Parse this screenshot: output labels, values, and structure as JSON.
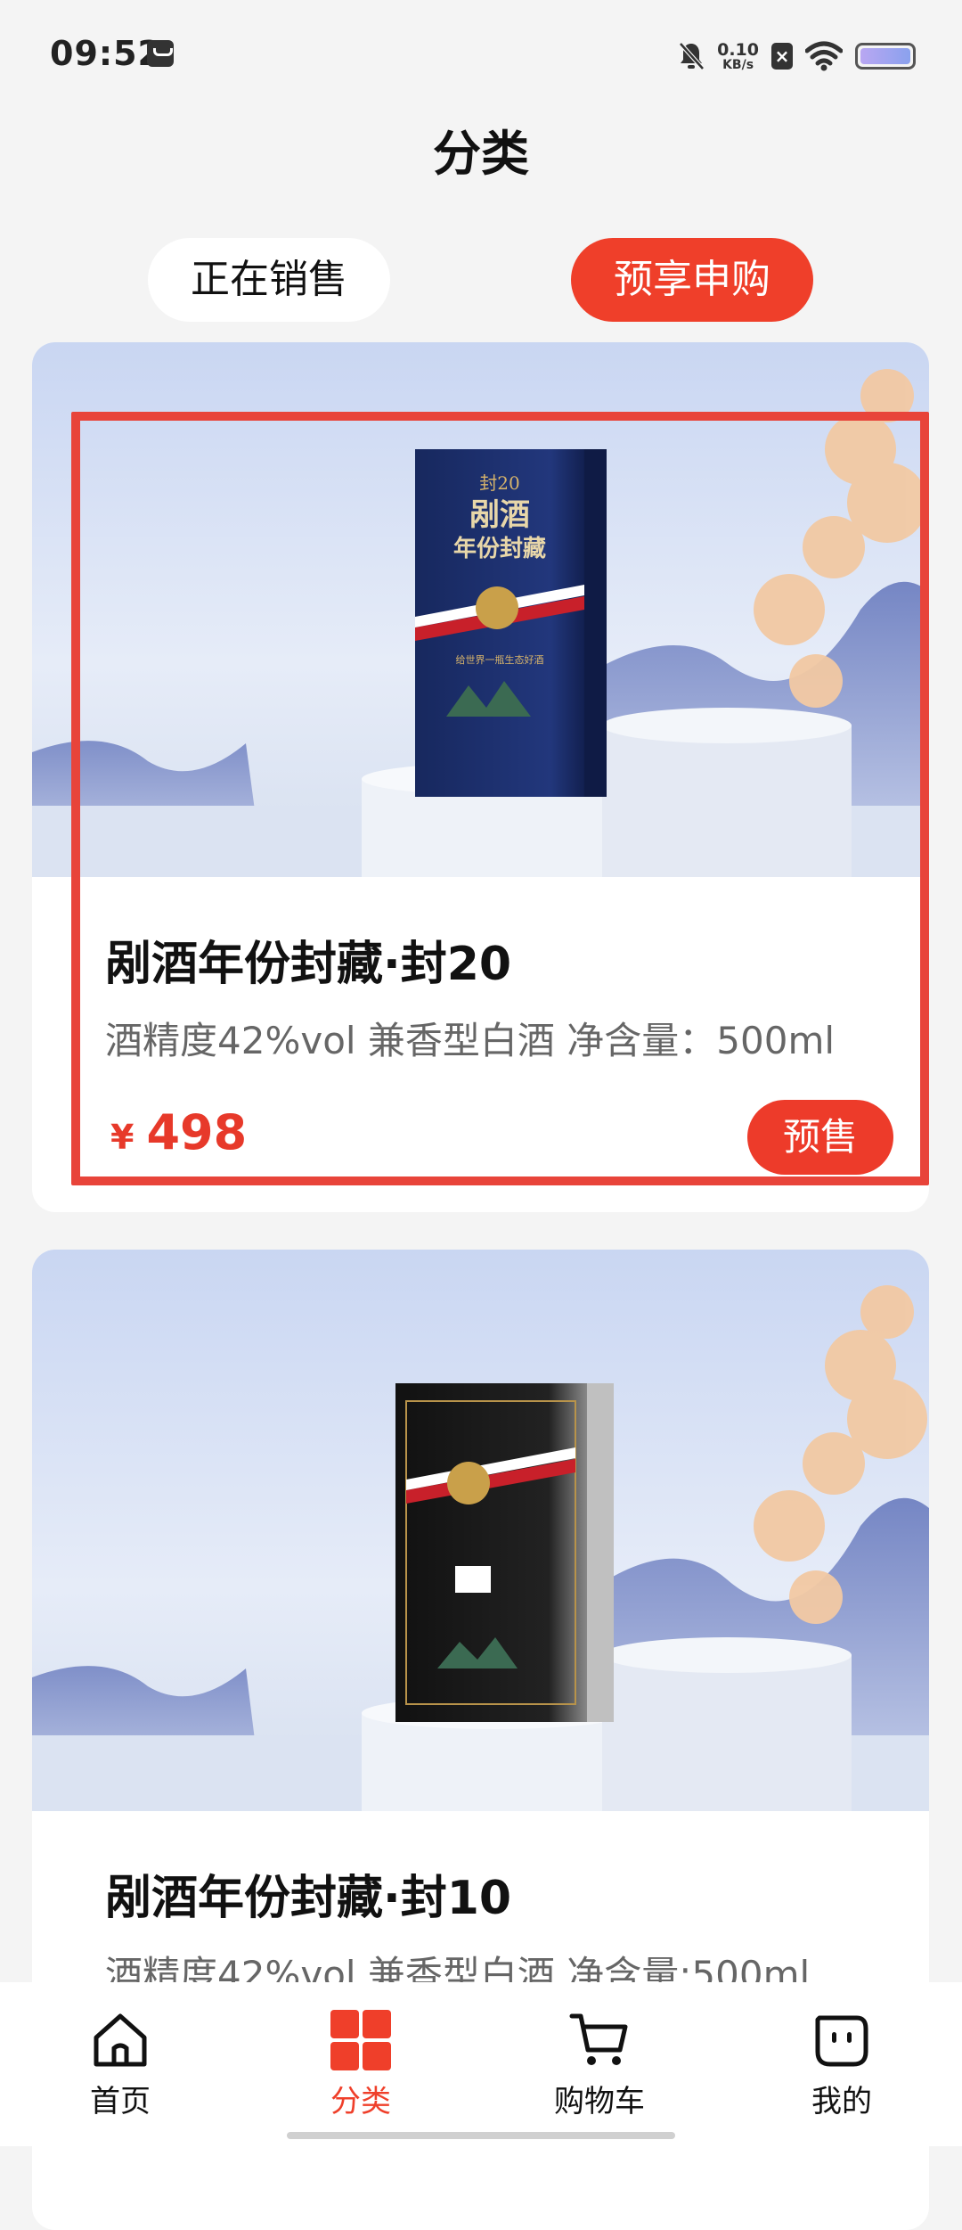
{
  "status_bar": {
    "time": "09:52",
    "net_speed_value": "0.10",
    "net_speed_unit": "KB/s",
    "sim_badge": "×",
    "icons": [
      "message-icon",
      "bell-off-icon",
      "sim-x-icon",
      "wifi-icon",
      "battery-icon"
    ]
  },
  "header": {
    "title": "分类"
  },
  "tabs": [
    {
      "label": "正在销售",
      "active": false
    },
    {
      "label": "预享申购",
      "active": true
    }
  ],
  "products": [
    {
      "name": "剐酒年份封藏·封20",
      "spec": "酒精度42%vol 兼香型白酒 净含量：500ml",
      "currency": "¥",
      "price": "498",
      "button_label": "预售",
      "box_label_top": "封20",
      "box_title_1": "剐酒",
      "box_title_2": "年份封藏",
      "box_slogan": "给世界一瓶生态好酒",
      "box_color": "#1d2f6b"
    },
    {
      "name": "剐酒年份封藏·封10",
      "spec": "酒精度42%vol 兼香型白酒 净含量:500ml",
      "box_color": "#1c1c1e"
    }
  ],
  "bottom_nav": [
    {
      "label": "首页",
      "icon": "home-icon",
      "active": false
    },
    {
      "label": "分类",
      "icon": "category-grid-icon",
      "active": true
    },
    {
      "label": "购物车",
      "icon": "cart-icon",
      "active": false
    },
    {
      "label": "我的",
      "icon": "profile-face-icon",
      "active": false
    }
  ],
  "colors": {
    "accent": "#ef3f2a",
    "price": "#e7392a",
    "background": "#f4f4f4"
  }
}
